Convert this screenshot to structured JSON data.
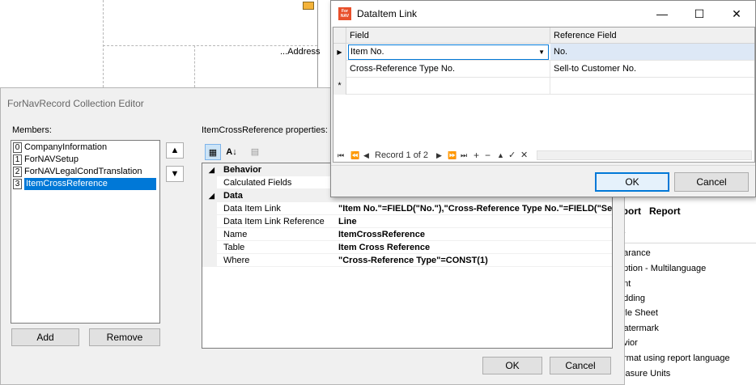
{
  "designer": {
    "address_label": "...Address"
  },
  "collection_editor": {
    "title": "ForNavRecord Collection Editor",
    "members_label": "Members:",
    "members": [
      {
        "index": "0",
        "name": "CompanyInformation"
      },
      {
        "index": "1",
        "name": "ForNAVSetup"
      },
      {
        "index": "2",
        "name": "ForNAVLegalCondTranslation"
      },
      {
        "index": "3",
        "name": "ItemCrossReference"
      }
    ],
    "selected_member": "3",
    "properties_label": "ItemCrossReference properties:",
    "categories": [
      {
        "name": "Behavior",
        "properties": [
          {
            "name": "Calculated Fields",
            "value": ""
          }
        ]
      },
      {
        "name": "Data",
        "properties": [
          {
            "name": "Data Item Link",
            "value": "\"Item No.\"=FIELD(\"No.\"),\"Cross-Reference Type No.\"=FIELD(\"Sell-to Customer No.\")"
          },
          {
            "name": "Data Item Link Reference",
            "value": "Line"
          },
          {
            "name": "Name",
            "value": "ItemCrossReference"
          },
          {
            "name": "Table",
            "value": "Item Cross Reference"
          },
          {
            "name": "Where",
            "value": "\"Cross-Reference Type\"=CONST(1)"
          }
        ]
      }
    ],
    "add_label": "Add",
    "remove_label": "Remove",
    "ok_label": "OK",
    "cancel_label": "Cancel"
  },
  "right_panel": {
    "header": "eport   Report",
    "items": [
      "earance",
      "aption - Multilanguage",
      "ont",
      "adding",
      "tyle Sheet",
      "Vatermark",
      "avior",
      "ormat using report language",
      "leasure Units"
    ]
  },
  "dataitem_link": {
    "title": "DataItem Link",
    "columns": [
      "Field",
      "Reference Field"
    ],
    "rows": [
      {
        "field": "Item No.",
        "reference": "No."
      },
      {
        "field": "Cross-Reference Type No.",
        "reference": "Sell-to Customer No."
      }
    ],
    "navigator": "Record 1 of 2",
    "ok_label": "OK",
    "cancel_label": "Cancel"
  },
  "colors": {
    "selection": "#0078d7",
    "dialog_bg": "#f0f0f0",
    "app_icon": "#e8502b"
  }
}
